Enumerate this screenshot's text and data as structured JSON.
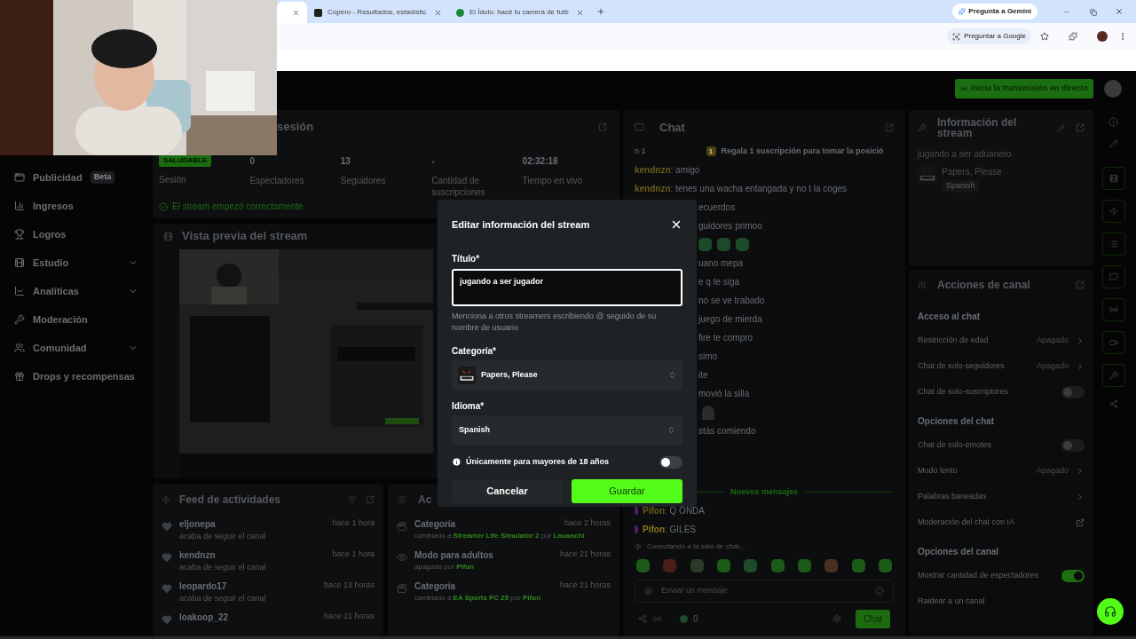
{
  "browser": {
    "tabs": [
      {
        "selected": true
      },
      {
        "title": "Copero - Resultados, estadístic",
        "kind": "square",
        "selected": false
      },
      {
        "title": "El Ídolo: hacé tu carrera de futb",
        "kind": "round",
        "selected": false
      }
    ],
    "gemini_button": "Pregunta a Gemini",
    "lens_chip": "Preguntar a Google"
  },
  "topbar": {
    "go_live": "Inicia la transmisión en directo"
  },
  "sidebar": {
    "items": [
      {
        "label": "Publicidad",
        "badge": "Beta",
        "kind": "ads",
        "has_submenu": false
      },
      {
        "label": "Ingresos",
        "kind": "revenue",
        "has_submenu": false
      },
      {
        "label": "Logros",
        "kind": "achievements",
        "has_submenu": false
      },
      {
        "label": "Estudio",
        "kind": "studio",
        "has_submenu": true
      },
      {
        "label": "Analíticas",
        "kind": "analytics",
        "has_submenu": true
      },
      {
        "label": "Moderación",
        "kind": "moderation",
        "has_submenu": false
      },
      {
        "label": "Comunidad",
        "kind": "community",
        "has_submenu": true
      },
      {
        "label": "Drops y recompensas",
        "kind": "drops",
        "has_submenu": false
      }
    ]
  },
  "session": {
    "title": "sesión",
    "stats": [
      {
        "value": "SALUDABLE",
        "label": "Sesión",
        "kind": "badge"
      },
      {
        "value": "0",
        "label": "Espectadores",
        "kind": "number"
      },
      {
        "value": "13",
        "label": "Seguidores",
        "kind": "number"
      },
      {
        "value": "-",
        "label": "Cantidad de suscripciones",
        "kind": "number"
      },
      {
        "value": "02:32:18",
        "label": "Tiempo en vivo",
        "kind": "number"
      }
    ],
    "status": "El stream empezó correctamente."
  },
  "preview": {
    "title": "Vista previa del stream"
  },
  "feed": {
    "title": "Feed de actividades",
    "items": [
      {
        "user": "eljonepa",
        "action": "acaba de seguir el canal",
        "time": "hace 1 hora"
      },
      {
        "user": "kendnzn",
        "action": "acaba de seguir el canal",
        "time": "hace 1 hora"
      },
      {
        "user": "leopardo17",
        "action": "acaba de seguir el canal",
        "time": "hace 13 horas"
      },
      {
        "user": "loakoop_22",
        "time": "hace 21 horas"
      }
    ]
  },
  "audit": {
    "title": "Ac",
    "items": [
      {
        "kind": "category",
        "title": "Categoría",
        "prefix": "cambiado a",
        "target": "Streamer Life Simulator 2",
        "joiner": "por",
        "user": "Lauanchi",
        "time": "hace 2 horas"
      },
      {
        "kind": "adult",
        "title": "Modo para adultos",
        "prefix": "apagado por",
        "user": "Pifon",
        "time": "hace 21 horas"
      },
      {
        "kind": "category",
        "title": "Categoría",
        "prefix": "cambiado a",
        "target": "EA Sports FC 25",
        "joiner": "por",
        "user": "Pifon",
        "time": "hace 21 horas"
      }
    ]
  },
  "chat": {
    "title": "Chat",
    "pinned": {
      "rank": "n 1",
      "badge": "1",
      "text": "Regala 1 suscripción para tomar la posició"
    },
    "messages": [
      {
        "kind": "message",
        "user": "kendnzn",
        "text": ": amigo",
        "color": "#6b5d1a"
      },
      {
        "kind": "message",
        "user": "kendnzn",
        "text": ": tenes una wacha entangada y no t la coges",
        "color": "#6b5d1a"
      },
      {
        "kind": "fragment",
        "text": "ecuerdos"
      },
      {
        "kind": "fragment",
        "text": "guidores primoo"
      },
      {
        "kind": "emotes"
      },
      {
        "kind": "fragment",
        "text": "uano mepa"
      },
      {
        "kind": "fragment",
        "text": "e q te siga"
      },
      {
        "kind": "fragment",
        "text": "no se ve trabado"
      },
      {
        "kind": "fragment",
        "text": "juego de mierda"
      },
      {
        "kind": "fragment",
        "text": "fire te compro"
      },
      {
        "kind": "fragment",
        "text": "simo"
      },
      {
        "kind": "fragment",
        "text": "ite"
      },
      {
        "kind": "fragment",
        "text": "movió la silla"
      },
      {
        "kind": "sticker"
      },
      {
        "kind": "fragment",
        "text": "stás comiendo"
      }
    ],
    "divider": "Nuevos mensajes",
    "recent": [
      {
        "user": "Pifon",
        "text": ": Q ONDA",
        "color": "#6b5d1a"
      },
      {
        "user": "Pifon",
        "text": ": GILES",
        "color": "#8a7818"
      }
    ],
    "connecting": "Conectando a la sala de chat...",
    "input_placeholder": "Enviar un mensaje",
    "viewer_count": "0",
    "send": "Chat"
  },
  "stream_info": {
    "title": "Información del stream",
    "stream_title": "jugando a ser aduanero",
    "category": "Papers, Please",
    "language": "Spanish"
  },
  "channel_actions": {
    "title": "Acciones de canal",
    "sections": [
      {
        "heading": "Acceso al chat",
        "rows": [
          {
            "kind": "select",
            "label": "Restricción de edad",
            "value": "Apagado"
          },
          {
            "kind": "select",
            "label": "Chat de solo-seguidores",
            "value": "Apagado"
          },
          {
            "kind": "toggle",
            "label": "Chat de solo-suscriptores",
            "on": false
          }
        ]
      },
      {
        "heading": "Opciones del chat",
        "rows": [
          {
            "kind": "toggle",
            "label": "Chat de solo-emotes",
            "on": false
          },
          {
            "kind": "select",
            "label": "Modo lento",
            "value": "Apagado"
          },
          {
            "kind": "link",
            "label": "Palabras baneadas"
          },
          {
            "kind": "external",
            "label": "Moderación del chat con IA"
          }
        ]
      },
      {
        "heading": "Opciones del canal",
        "rows": [
          {
            "kind": "toggle",
            "label": "Mostrar cantidad de espectadores",
            "on": true
          },
          {
            "kind": "plain",
            "label": "Raidear a un canal"
          }
        ]
      }
    ]
  },
  "modal": {
    "title": "Editar información del stream",
    "title_label": "Título*",
    "title_value": "jugando a ser jugador",
    "hint": "Menciona a otros streamers escribiendo @ seguido de su nombre de usuario",
    "category_label": "Categoría*",
    "category": "Papers, Please",
    "language_label": "Idioma*",
    "language": "Spanish",
    "mature_label": "Únicamente para mayores de 18 años",
    "mature_on": false,
    "cancel": "Cancelar",
    "save": "Guardar"
  }
}
